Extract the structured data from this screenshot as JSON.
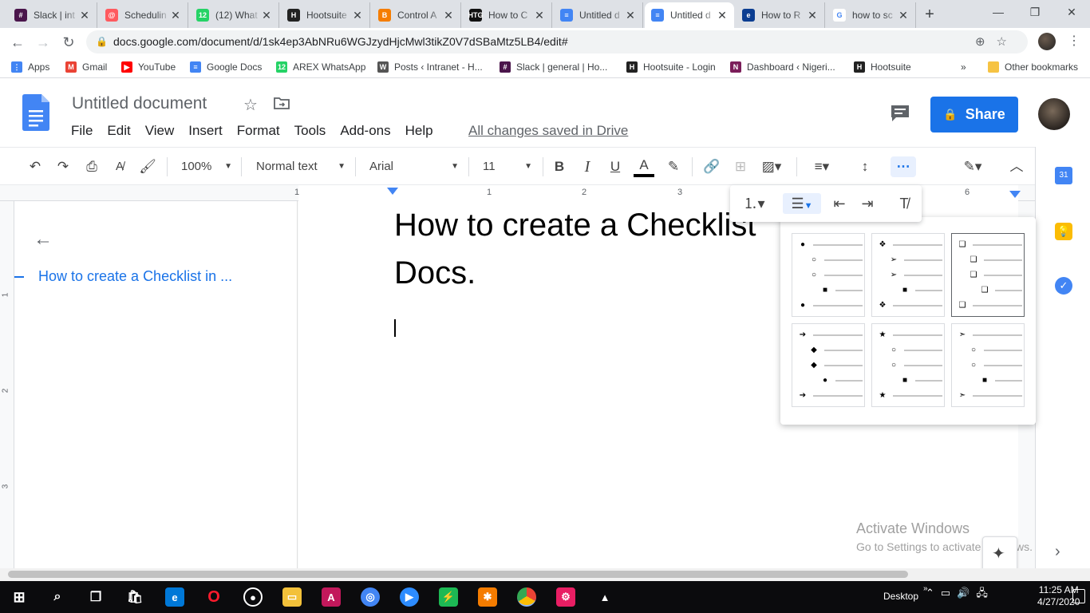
{
  "browser": {
    "tabs": [
      {
        "title": "Slack | int",
        "favicon_color": "#4a154b",
        "glyph": "#"
      },
      {
        "title": "Schedulin",
        "favicon_color": "#ff5a5f",
        "glyph": "@"
      },
      {
        "title": "(12) What",
        "favicon_color": "#25d366",
        "glyph": "12"
      },
      {
        "title": "Hootsuite",
        "favicon_color": "#222222",
        "glyph": "H"
      },
      {
        "title": "Control A",
        "favicon_color": "#f57d00",
        "glyph": "B"
      },
      {
        "title": "How to C",
        "favicon_color": "#111111",
        "glyph": "HTG"
      },
      {
        "title": "Untitled d",
        "favicon_color": "#4285f4",
        "glyph": "≡"
      },
      {
        "title": "Untitled d",
        "favicon_color": "#4285f4",
        "glyph": "≡"
      },
      {
        "title": "How to R",
        "favicon_color": "#0b3d91",
        "glyph": "e"
      },
      {
        "title": "how to sc",
        "favicon_color": "#ffffff",
        "glyph": "G"
      }
    ],
    "active_tab_index": 7,
    "url": "docs.google.com/document/d/1sk4ep3AbNRu6WGJzydHjcMwl3tikZ0V7dSBaMtz5LB4/edit#",
    "bookmarks": [
      {
        "label": "Apps",
        "color": "#4285f4",
        "glyph": "⋮"
      },
      {
        "label": "Gmail",
        "color": "#ea4335",
        "glyph": "M"
      },
      {
        "label": "YouTube",
        "color": "#ff0000",
        "glyph": "▶"
      },
      {
        "label": "Google Docs",
        "color": "#4285f4",
        "glyph": "≡"
      },
      {
        "label": "AREX WhatsApp",
        "color": "#25d366",
        "glyph": "12"
      },
      {
        "label": "Posts ‹ Intranet - H...",
        "color": "#555555",
        "glyph": "W"
      },
      {
        "label": "Slack | general | Ho...",
        "color": "#4a154b",
        "glyph": "#"
      },
      {
        "label": "Hootsuite - Login",
        "color": "#222222",
        "glyph": "H"
      },
      {
        "label": "Dashboard ‹ Nigeri...",
        "color": "#7b1e5a",
        "glyph": "N"
      },
      {
        "label": "Hootsuite",
        "color": "#222222",
        "glyph": "H"
      }
    ],
    "bookmarks_more": "»",
    "other_bookmarks": "Other bookmarks"
  },
  "docs": {
    "title": "Untitled document",
    "menu": [
      "File",
      "Edit",
      "View",
      "Insert",
      "Format",
      "Tools",
      "Add-ons",
      "Help"
    ],
    "save_status": "All changes saved in Drive",
    "share_label": "Share",
    "toolbar": {
      "zoom": "100%",
      "style": "Normal text",
      "font": "Arial",
      "size": "11"
    },
    "ruler_numbers": [
      "1",
      "1",
      "2",
      "3",
      "6"
    ],
    "vruler_numbers": [
      "1",
      "2",
      "3"
    ],
    "outline_item": "How to create a Checklist in ...",
    "heading_line1": "How to create a Checklist",
    "heading_line2": "Docs."
  },
  "watermark": {
    "line1": "Activate Windows",
    "line2": "Go to Settings to activate Windows."
  },
  "taskbar": {
    "desktop_label": "Desktop",
    "time": "11:25 AM",
    "date": "4/27/2020"
  },
  "colors": {
    "accent": "#1a73e8",
    "share": "#1a73e8",
    "taskbar": "#0b0b0d"
  }
}
